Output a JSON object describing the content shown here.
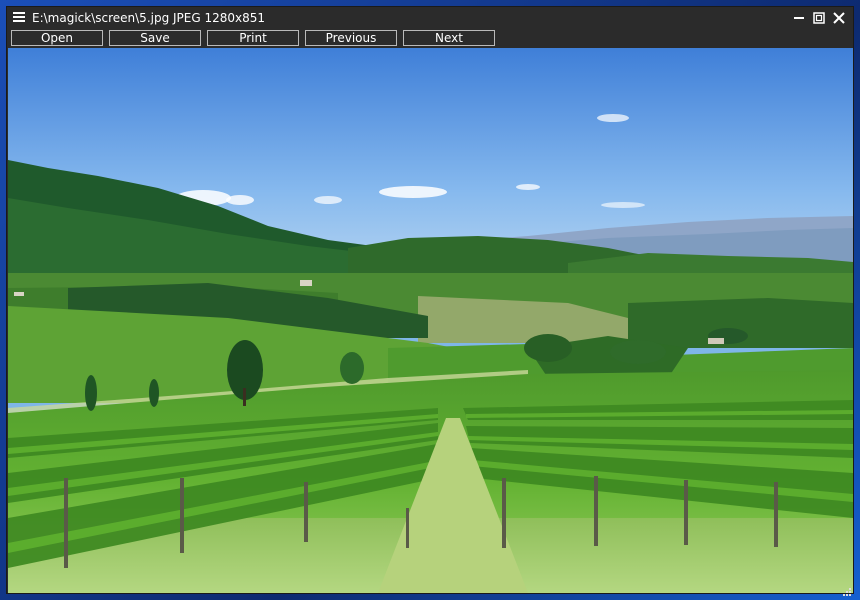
{
  "window": {
    "title": "E:\\magick\\screen\\5.jpg JPEG 1280x851"
  },
  "toolbar": {
    "open_label": "Open",
    "save_label": "Save",
    "print_label": "Print",
    "previous_label": "Previous",
    "next_label": "Next"
  },
  "icons": {
    "menu": "hamburger-menu-icon",
    "minimize": "minimize-icon",
    "maximize": "maximize-icon",
    "close": "close-icon",
    "resize": "resize-grip-icon"
  },
  "colors": {
    "chrome": "#2b2b2b",
    "button_border": "#b9b9b9",
    "text": "#ffffff"
  }
}
